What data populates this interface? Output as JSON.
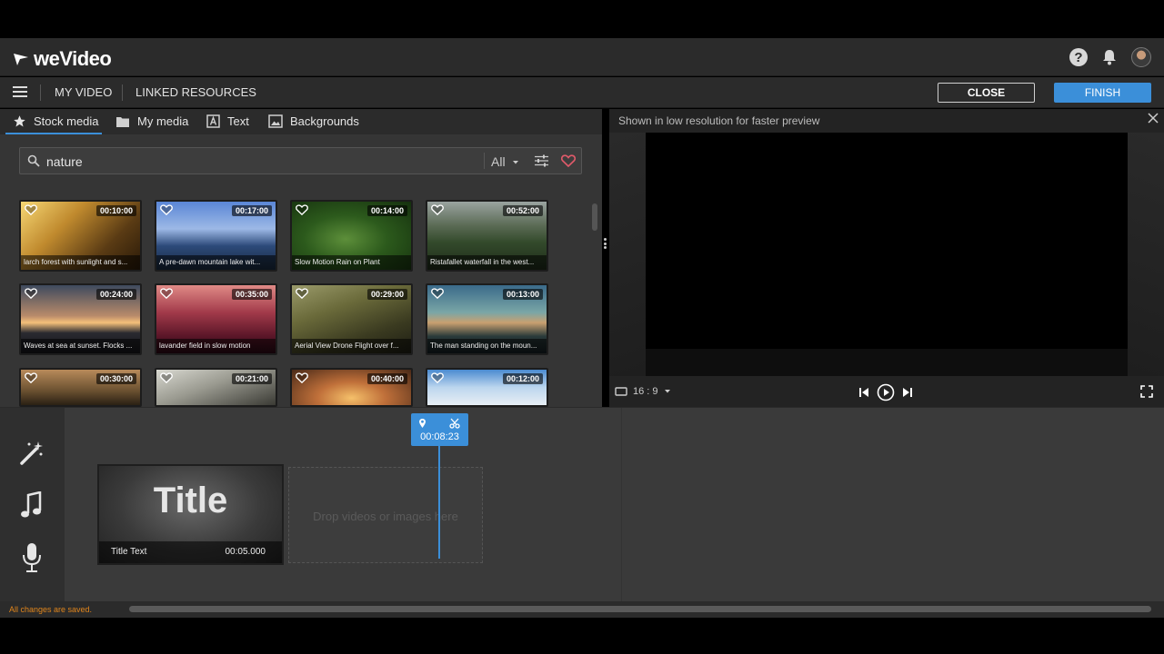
{
  "app": {
    "name": "weVideo"
  },
  "menu": {
    "items": [
      "MY VIDEO",
      "LINKED RESOURCES"
    ],
    "close_label": "CLOSE",
    "finish_label": "FINISH"
  },
  "tabs": [
    {
      "label": "Stock media",
      "icon": "star-icon",
      "active": true
    },
    {
      "label": "My media",
      "icon": "folder-icon"
    },
    {
      "label": "Text",
      "icon": "text-icon"
    },
    {
      "label": "Backgrounds",
      "icon": "image-icon"
    }
  ],
  "search": {
    "value": "nature",
    "filter": "All"
  },
  "media": [
    {
      "duration": "00:10:00",
      "caption": "larch forest with sunlight and s..."
    },
    {
      "duration": "00:17:00",
      "caption": "A pre-dawn mountain lake wit..."
    },
    {
      "duration": "00:14:00",
      "caption": "Slow Motion Rain on Plant"
    },
    {
      "duration": "00:52:00",
      "caption": "Ristafallet waterfall in the west..."
    },
    {
      "duration": "00:24:00",
      "caption": "Waves at sea at sunset. Flocks ..."
    },
    {
      "duration": "00:35:00",
      "caption": "lavander field in slow motion"
    },
    {
      "duration": "00:29:00",
      "caption": "Aerial View Drone Flight over f..."
    },
    {
      "duration": "00:13:00",
      "caption": "The man standing on the moun..."
    },
    {
      "duration": "00:30:00",
      "caption": ""
    },
    {
      "duration": "00:21:00",
      "caption": ""
    },
    {
      "duration": "00:40:00",
      "caption": ""
    },
    {
      "duration": "00:12:00",
      "caption": ""
    }
  ],
  "preview": {
    "note": "Shown in low resolution for faster preview",
    "aspect_ratio": "16 : 9"
  },
  "timeline": {
    "playhead_time": "00:08:23",
    "title_clip": {
      "preview_text": "Title",
      "name": "Title Text",
      "duration": "00:05.000"
    },
    "drop_text": "Drop videos or images here"
  },
  "status": {
    "saved_text": "All changes are saved."
  },
  "colors": {
    "accent": "#3b8fd9",
    "saved": "#e0851c",
    "heart": "#e05a6a"
  }
}
